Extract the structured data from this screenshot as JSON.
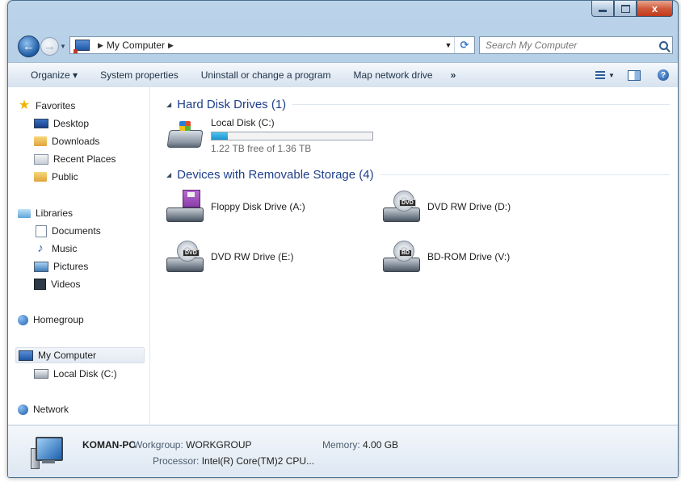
{
  "window": {
    "caption_buttons": {
      "close_label": "x"
    }
  },
  "address": {
    "breadcrumb": [
      "My Computer"
    ],
    "search_placeholder": "Search My Computer"
  },
  "toolbar": {
    "items": [
      "Organize ▾",
      "System properties",
      "Uninstall or change a program",
      "Map network drive"
    ],
    "overflow": "»"
  },
  "nav": {
    "favorites": {
      "label": "Favorites",
      "items": [
        "Desktop",
        "Downloads",
        "Recent Places",
        "Public"
      ]
    },
    "libraries": {
      "label": "Libraries",
      "items": [
        "Documents",
        "Music",
        "Pictures",
        "Videos"
      ]
    },
    "homegroup": "Homegroup",
    "computer": {
      "label": "My Computer",
      "items": [
        "Local Disk (C:)"
      ]
    },
    "network": "Network"
  },
  "content": {
    "hard_disks": {
      "header": "Hard Disk Drives (1)",
      "drives": [
        {
          "name": "Local Disk (C:)",
          "free_text": "1.22 TB free of 1.36 TB",
          "used_fraction": 0.1
        }
      ]
    },
    "removable": {
      "header": "Devices with Removable Storage (4)",
      "drives": [
        {
          "name": "Floppy Disk Drive (A:)",
          "icon": "floppy-drive-icon"
        },
        {
          "name": "DVD RW Drive (D:)",
          "icon": "dvd-drive-icon",
          "badge": "DVD"
        },
        {
          "name": "DVD RW Drive (E:)",
          "icon": "dvd-drive-icon",
          "badge": "DVD"
        },
        {
          "name": "BD-ROM Drive (V:)",
          "icon": "bd-drive-icon",
          "badge": "BD"
        }
      ]
    }
  },
  "details": {
    "computer_name": "KOMAN-PC",
    "workgroup_label": "Workgroup:",
    "workgroup_value": "WORKGROUP",
    "memory_label": "Memory:",
    "memory_value": "4.00 GB",
    "processor_label": "Processor:",
    "processor_value": "Intel(R) Core(TM)2 CPU..."
  }
}
